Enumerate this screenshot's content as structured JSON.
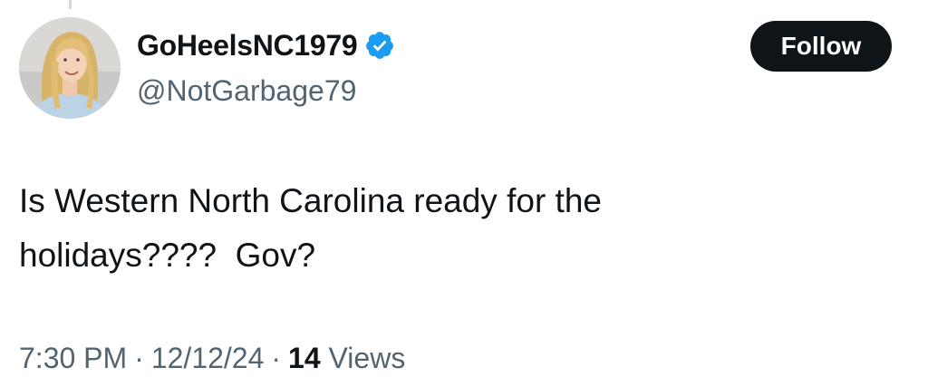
{
  "user": {
    "display_name": "GoHeelsNC1979",
    "handle": "@NotGarbage79",
    "verified": true,
    "verified_color": "#1d9bf0"
  },
  "follow_button": {
    "label": "Follow",
    "background": "#0f1419",
    "text_color": "#ffffff"
  },
  "tweet": {
    "text": "Is Western North Carolina ready for the\nholidays????  Gov?"
  },
  "meta": {
    "time": "7:30 PM",
    "separator": "·",
    "date": "12/12/24",
    "views_count": "14",
    "views_label": "Views"
  },
  "icons": {
    "avatar": "profile-photo",
    "verified": "verified-badge-icon"
  }
}
